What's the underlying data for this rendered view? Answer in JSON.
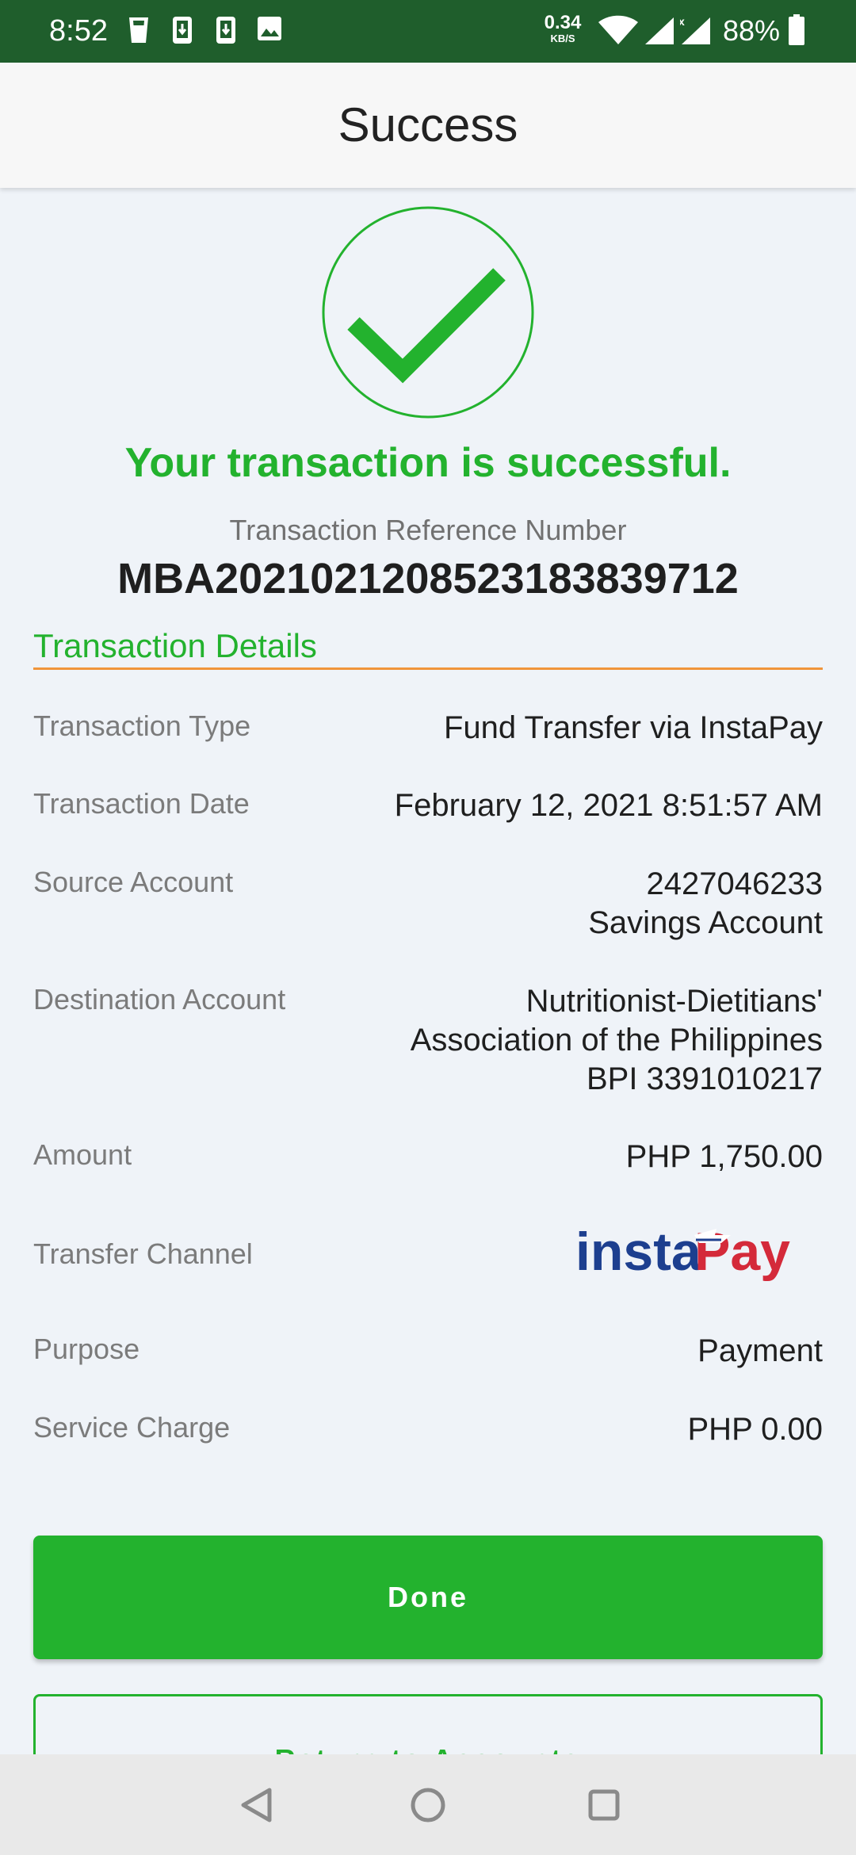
{
  "status_bar": {
    "time": "8:52",
    "net_speed_value": "0.34",
    "net_speed_unit": "KB/S",
    "battery": "88%",
    "icons": [
      "glass-icon",
      "download-icon",
      "download-icon",
      "image-icon",
      "wifi-icon",
      "signal-icon",
      "signal-icon",
      "battery-icon"
    ]
  },
  "app_bar": {
    "title": "Success"
  },
  "result": {
    "icon": "check-circle-icon",
    "message": "Your transaction is successful.",
    "reference_label": "Transaction Reference Number",
    "reference_number": "MBA20210212085231838397​12"
  },
  "details": {
    "heading": "Transaction Details",
    "transaction_type": {
      "label": "Transaction Type",
      "value": "Fund Transfer via InstaPay"
    },
    "transaction_date": {
      "label": "Transaction Date",
      "value": "February 12, 2021 8:51:57 AM"
    },
    "source_account": {
      "label": "Source Account",
      "line1": "2427046233",
      "line2": "Savings Account"
    },
    "destination_account": {
      "label": "Destination Account",
      "line1": "Nutritionist-Dietitians'",
      "line2": "Association of the Philippines",
      "line3": "BPI 3391010217"
    },
    "amount": {
      "label": "Amount",
      "value": "PHP 1,750.00"
    },
    "transfer_channel": {
      "label": "Transfer Channel",
      "logo_text_blue": "insta",
      "logo_text_red": "Pay"
    },
    "purpose": {
      "label": "Purpose",
      "value": "Payment"
    },
    "service_charge": {
      "label": "Service Charge",
      "value": "PHP 0.00"
    }
  },
  "actions": {
    "done_label": "Done",
    "return_label": "Return to Accounts"
  },
  "nav_bar": {
    "icons": [
      "back-icon",
      "home-icon",
      "recents-icon"
    ]
  },
  "colors": {
    "status_bar": "#1f5e2c",
    "accent_green": "#23b22e",
    "rule_orange": "#f0953a",
    "instapay_blue": "#1d3f8f",
    "instapay_red": "#d42a3a"
  }
}
